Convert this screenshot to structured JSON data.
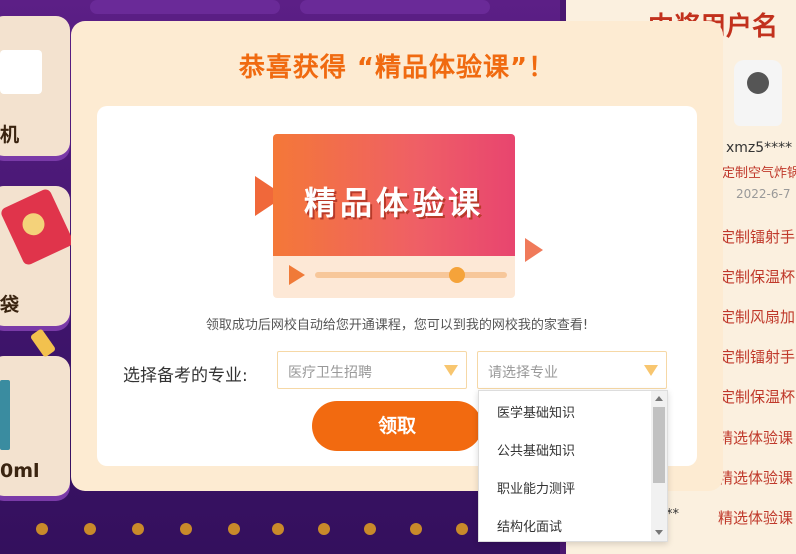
{
  "background": {
    "card_labels": [
      "机",
      "袋",
      "0ml"
    ],
    "right_panel": {
      "title": "中奖用户名",
      "winner_user": "xmz5****",
      "winner_prize": "定制空气炸锅",
      "winner_date": "2022-6-7",
      "prize_list": [
        "定制镭射手",
        "定制保温杯",
        "定制风扇加",
        "定制镭射手",
        "定制保温杯",
        "精选体验课",
        "精选体验课",
        "精选体验课"
      ],
      "masked_user": "**"
    }
  },
  "modal": {
    "title": "恭喜获得 “精品体验课”！",
    "banner_text": "精品体验课",
    "note": "领取成功后网校自动给您开通课程，您可以到我的网校我的家查看!",
    "select_label": "选择备考的专业:",
    "exam_select_value": "医疗卫生招聘",
    "major_select_placeholder": "请选择专业",
    "claim_button": "领取",
    "dropdown_options": [
      "医学基础知识",
      "公共基础知识",
      "职业能力测评",
      "结构化面试"
    ]
  }
}
